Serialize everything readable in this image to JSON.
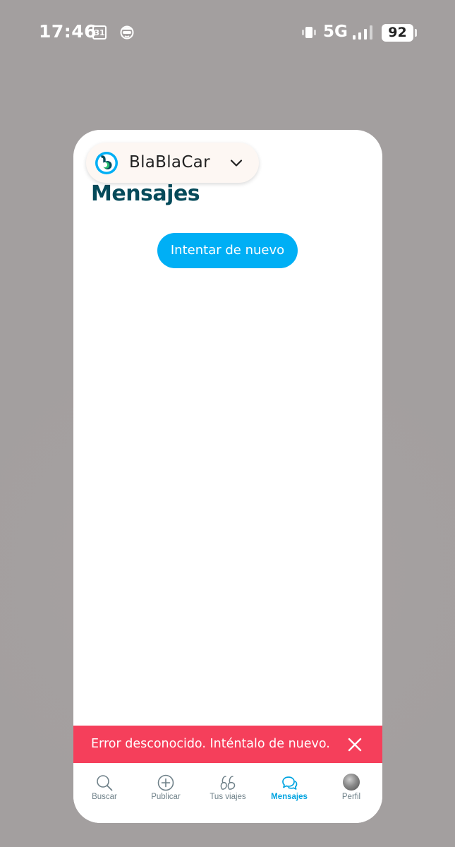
{
  "status_bar": {
    "time": "17:46",
    "calendar_day": "31",
    "network": "5G",
    "battery": "92"
  },
  "app_chip": {
    "name": "BlaBlaCar"
  },
  "page": {
    "title": "Mensajes",
    "retry_label": "Intentar de nuevo"
  },
  "error_banner": {
    "message": "Error desconocido. Inténtalo de nuevo."
  },
  "bottom_nav": {
    "active": "Mensajes",
    "items": [
      {
        "label": "Buscar",
        "icon": "search-icon"
      },
      {
        "label": "Publicar",
        "icon": "plus-circle-icon"
      },
      {
        "label": "Tus viajes",
        "icon": "trips-icon"
      },
      {
        "label": "Mensajes",
        "icon": "chat-icon"
      },
      {
        "label": "Perfil",
        "icon": "avatar"
      }
    ]
  },
  "colors": {
    "accent": "#00aff5",
    "title": "#054a5a",
    "error": "#f53f5b",
    "nav_active": "#00a3e0"
  }
}
